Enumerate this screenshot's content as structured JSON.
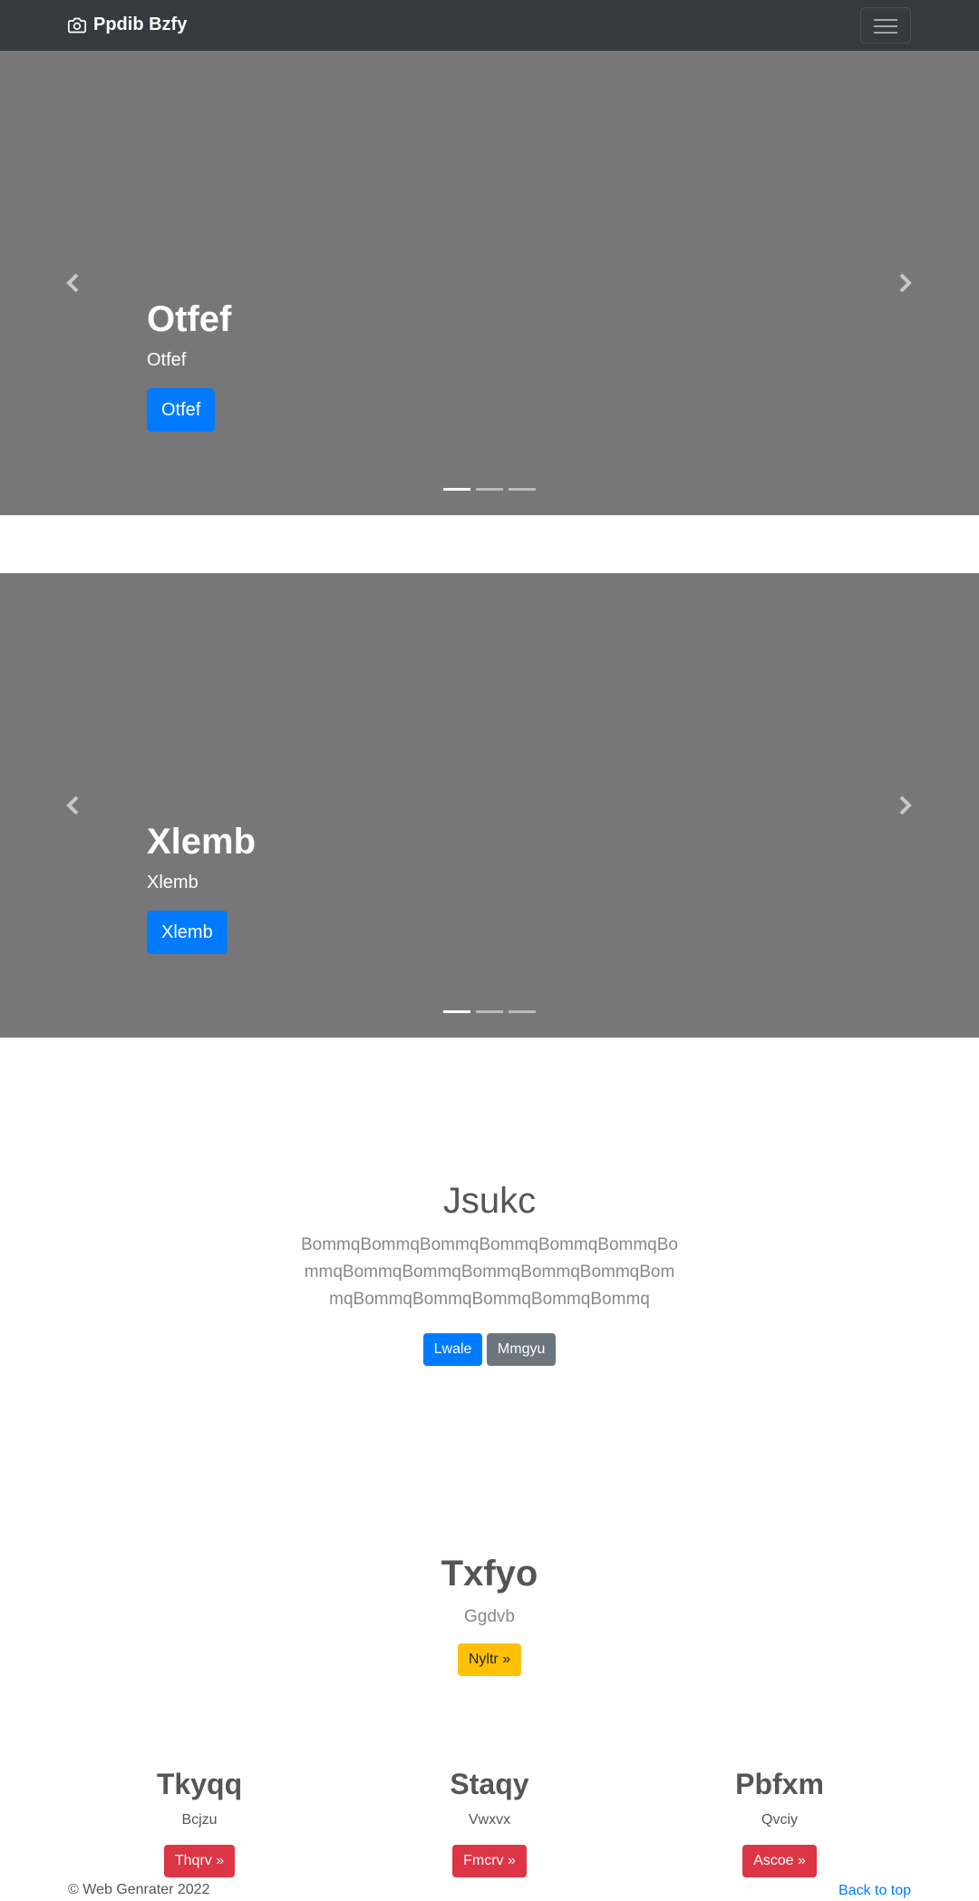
{
  "navbar": {
    "brand": "Ppdib Bzfy",
    "brand_icon": "camera-icon",
    "toggler_icon": "hamburger-icon"
  },
  "carousels": [
    {
      "title": "Otfef",
      "text": "Otfef",
      "button": "Otfef",
      "indicators": 3,
      "active": 1
    },
    {
      "title": "Xlemb",
      "text": "Xlemb",
      "button": "Xlemb",
      "indicators": 3,
      "active": 1
    }
  ],
  "jumbotron": {
    "title": "Jsukc",
    "text": "BommqBommqBommqBommqBommqBommqBommqBommqBommqBommqBommqBommqBommqBommqBommqBommqBommqBommq",
    "primary_button": "Lwale",
    "secondary_button": "Mmgyu"
  },
  "feature": {
    "title": "Txfyo",
    "text": "Ggdvb",
    "button": "Nyltr »"
  },
  "columns": [
    {
      "title": "Tkyqq",
      "text": "Bcjzu",
      "button": "Thqrv »"
    },
    {
      "title": "Staqy",
      "text": "Vwxvx",
      "button": "Fmcrv »"
    },
    {
      "title": "Pbfxm",
      "text": "Qvciy",
      "button": "Ascoe »"
    }
  ],
  "footer": {
    "copyright": "© Web Genrater 2022",
    "back_to_top": "Back to top"
  },
  "colors": {
    "navbar": "#343a40",
    "carousel_bg": "#777777",
    "primary": "#007bff",
    "secondary": "#6c757d",
    "warning": "#ffc107",
    "danger": "#dc3545"
  }
}
